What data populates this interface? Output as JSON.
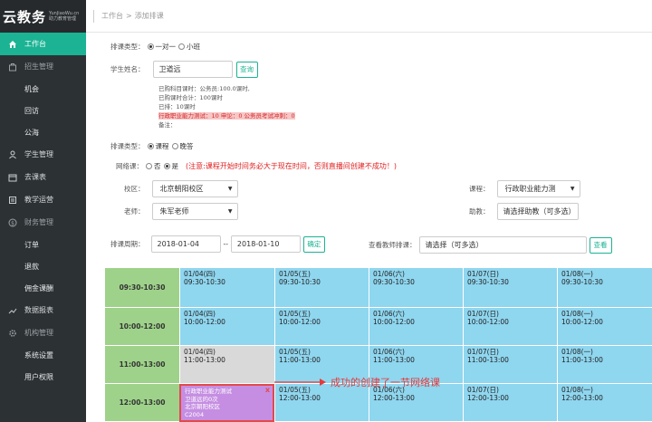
{
  "app": {
    "title": "云教务",
    "sub_line1": "YunJiaoWu.cn",
    "sub_line2": "助力教育管理"
  },
  "sidebar": {
    "items": [
      {
        "label": "工作台",
        "icon": "home-icon"
      },
      {
        "label": "招生管理",
        "icon": "bag-icon"
      },
      {
        "label": "机会",
        "icon": ""
      },
      {
        "label": "回访",
        "icon": ""
      },
      {
        "label": "公海",
        "icon": ""
      },
      {
        "label": "学生管理",
        "icon": "user-icon"
      },
      {
        "label": "去课表",
        "icon": "calendar-icon"
      },
      {
        "label": "教学运营",
        "icon": "book-icon"
      },
      {
        "label": "财务管理",
        "icon": "dollar-icon"
      },
      {
        "label": "订单",
        "icon": ""
      },
      {
        "label": "退款",
        "icon": ""
      },
      {
        "label": "佣金课酬",
        "icon": ""
      },
      {
        "label": "数据报表",
        "icon": "chart-icon"
      },
      {
        "label": "机构管理",
        "icon": "gear-icon"
      },
      {
        "label": "系统设置",
        "icon": ""
      },
      {
        "label": "用户权限",
        "icon": ""
      }
    ]
  },
  "breadcrumb": {
    "root": "工作台",
    "sep": ">",
    "current": "添加排课"
  },
  "form": {
    "type_label": "排课类型：",
    "type_opt1": "一对一",
    "type_opt2": "小班",
    "student_label": "学生姓名：",
    "student_value": "卫道远",
    "query_btn": "查询",
    "info_line1": "已购科目课时：公务员:100.0课时,",
    "info_line2": "已购课时合计：100课时",
    "info_line3": "已排：10课时",
    "info_line4": "行政职业能力测试：10   申论：0   公务员考试冲刺：0",
    "info_line5": "备注：",
    "class_type_label": "排课类型：",
    "class_type_opt1": "课程",
    "class_type_opt2": "晚答",
    "online_label": "网络课：",
    "online_no": "否",
    "online_yes": "是",
    "online_note": "(注意:课程开始时间务必大于现在时间，否则直播间创建不成功！)",
    "campus_label": "校区：",
    "campus_value": "北京朝阳校区",
    "teacher_label": "老师：",
    "teacher_value": "朱军老师",
    "course_label": "课程：",
    "course_value": "行政职业能力测",
    "assistant_label": "助教：",
    "assistant_value": "请选择助教（可多选）",
    "period_label": "排课周期：",
    "date_start": "2018-01-04",
    "date_sep": "--",
    "date_end": "2018-01-10",
    "confirm_btn": "确定",
    "check_teacher_label": "查看教师排课：",
    "check_teacher_value": "请选择（可多选）",
    "check_btn": "查看"
  },
  "schedule": {
    "slots": [
      "09:30-10:30",
      "10:00-12:00",
      "11:00-13:00",
      "12:00-13:00"
    ],
    "days": [
      "01/04(四)",
      "01/05(五)",
      "01/06(六)",
      "01/07(日)",
      "01/08(一)"
    ],
    "cells": [
      [
        "09:30-10:30",
        "09:30-10:30",
        "09:30-10:30",
        "09:30-10:30",
        "09:30-10:30"
      ],
      [
        "10:00-12:00",
        "10:00-12:00",
        "10:00-12:00",
        "10:00-12:00",
        "10:00-12:00"
      ],
      [
        "11:00-13:00",
        "11:00-13:00",
        "11:00-13:00",
        "11:00-13:00",
        "11:00-13:00"
      ],
      [
        "",
        "12:00-13:00",
        "12:00-13:00",
        "12:00-13:00",
        "12:00-13:00"
      ]
    ],
    "lesson": {
      "course": "行政职业能力测试",
      "student": "卫道远的0次",
      "campus": "北京朝阳校区",
      "room": "C2004",
      "close": "x"
    },
    "annotation": "成功的创建了一节网络课"
  },
  "colors": {
    "accent": "#1bb394",
    "sidebar": "#2c3134",
    "grid": "#8fd6ef",
    "time": "#9ed28a",
    "lesson": "#c58ee2",
    "warn": "#e02020"
  }
}
